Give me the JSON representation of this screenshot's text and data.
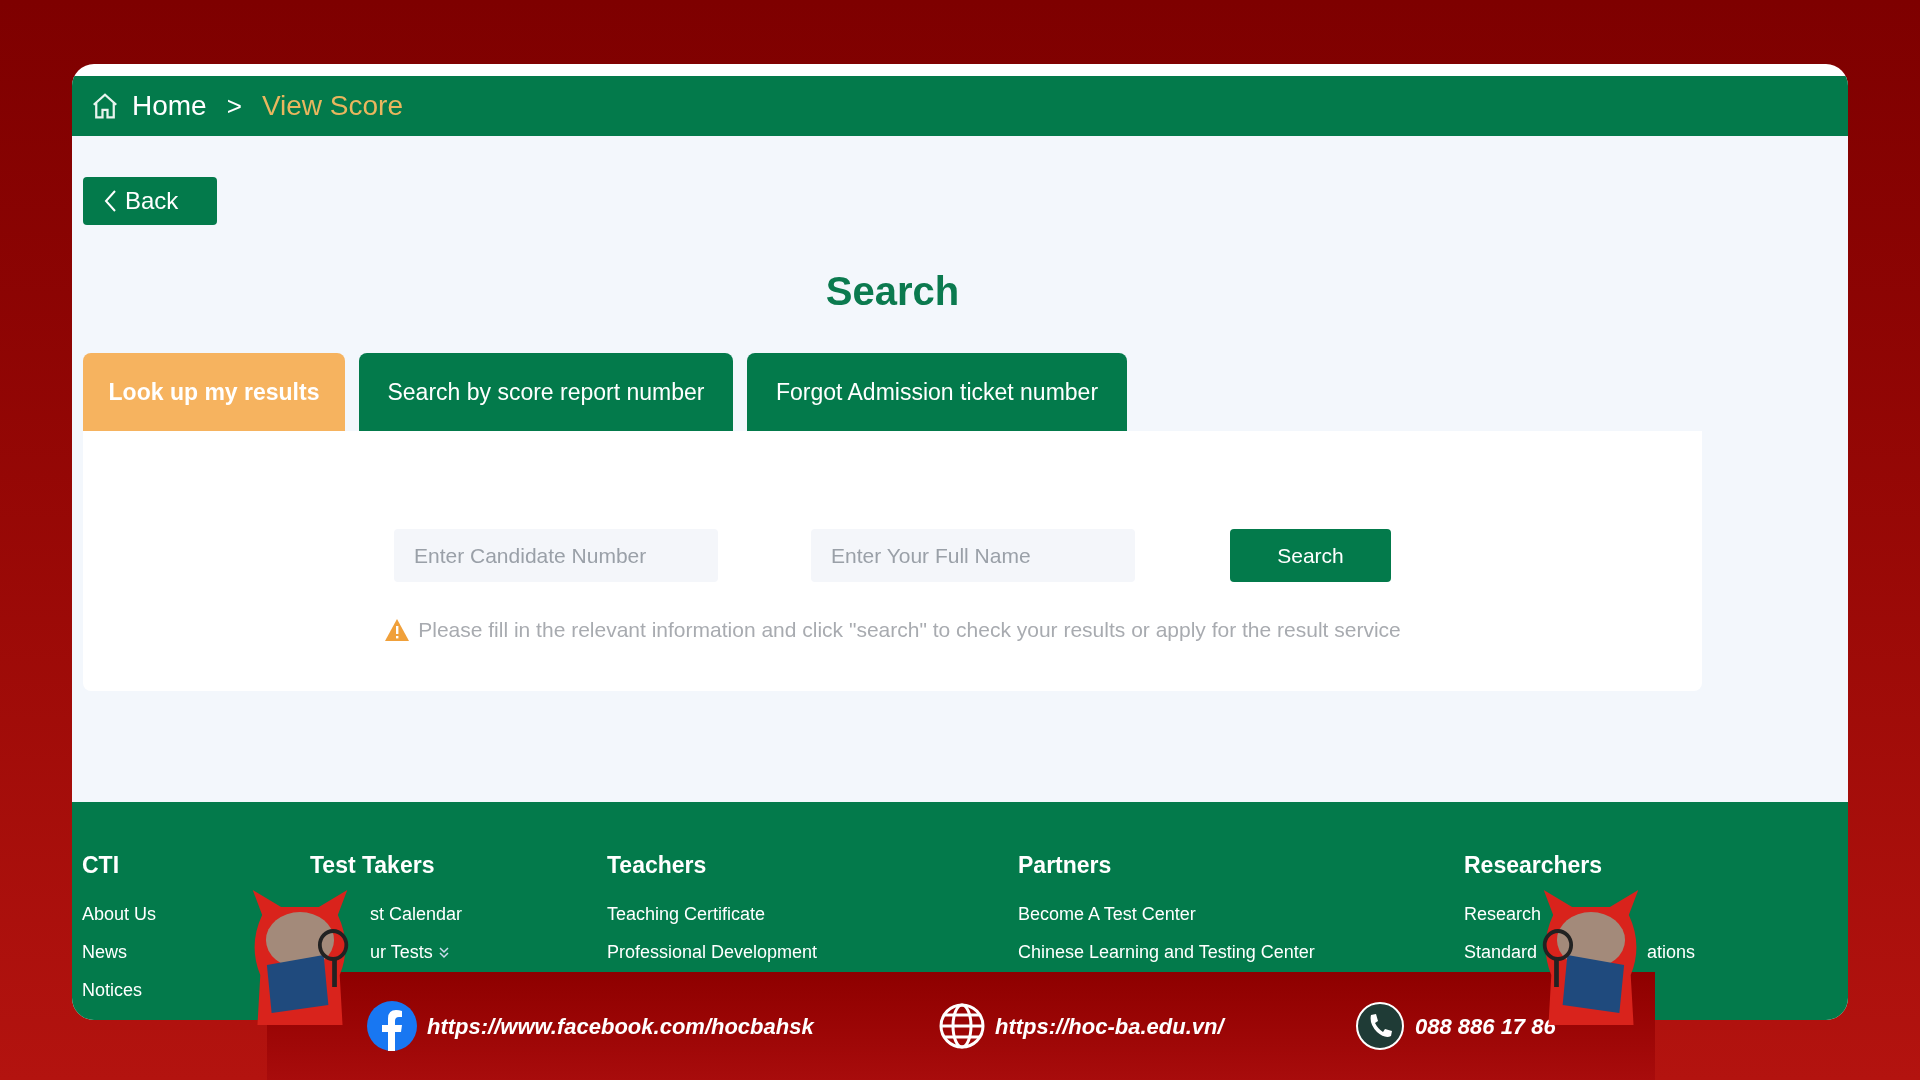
{
  "breadcrumb": {
    "home": "Home",
    "separator": ">",
    "current": "View Score"
  },
  "back_button": "Back",
  "title": "Search",
  "tabs": [
    {
      "label": "Look up my results",
      "selected": true
    },
    {
      "label": "Search by score report number",
      "selected": false
    },
    {
      "label": "Forgot Admission ticket number",
      "selected": false
    }
  ],
  "form": {
    "fields": [
      {
        "placeholder": "Enter Candidate Number"
      },
      {
        "placeholder": "Enter Your Full Name"
      }
    ],
    "button": "Search",
    "notice": "Please fill in the relevant information and click \"search\" to check your results or apply for the result service"
  },
  "footer": {
    "columns": [
      {
        "heading": "CTI",
        "links": [
          {
            "parts": [
              "About Us"
            ]
          },
          {
            "parts": [
              "News"
            ]
          },
          {
            "parts": [
              "Notices"
            ]
          }
        ]
      },
      {
        "heading": "Test Takers",
        "links": [
          {
            "parts": [
              "st Calendar"
            ]
          },
          {
            "parts": [
              "ur Tests"
            ],
            "has_menu": true
          }
        ]
      },
      {
        "heading": "Teachers",
        "links": [
          {
            "parts": [
              "Teaching Certificate"
            ]
          },
          {
            "parts": [
              "Professional Development"
            ]
          }
        ]
      },
      {
        "heading": "Partners",
        "links": [
          {
            "parts": [
              "Become A Test Center"
            ]
          },
          {
            "parts": [
              "Chinese Learning and Testing Center"
            ]
          }
        ]
      },
      {
        "heading": "Researchers",
        "links": [
          {
            "parts": [
              "Research"
            ]
          },
          {
            "parts": [
              "Standard",
              "ations"
            ]
          }
        ]
      }
    ]
  },
  "contact_bar": {
    "facebook": "https://www.facebook.com/hocbahsk",
    "website": "https://hoc-ba.edu.vn/",
    "phone": "088 886 17 86"
  }
}
